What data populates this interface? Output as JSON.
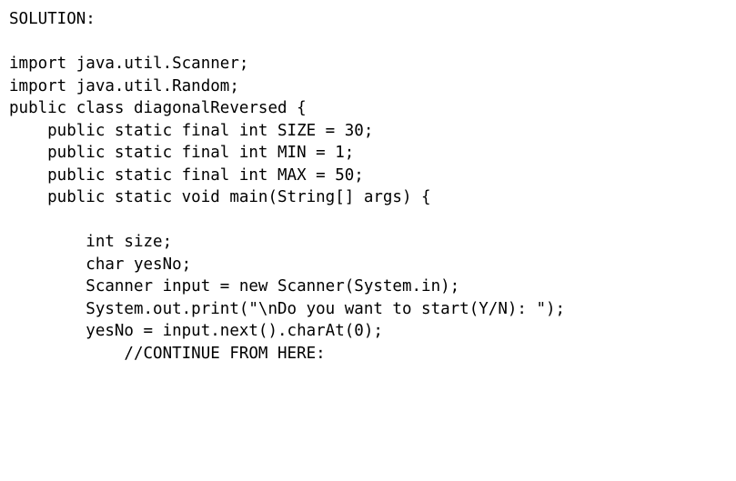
{
  "document": {
    "heading": "SOLUTION:",
    "language": "java",
    "background_color": "#ffffff",
    "text_color": "#000000",
    "class_name": "diagonalReversed",
    "constants": [
      {
        "name": "SIZE",
        "type": "int",
        "value": "30"
      },
      {
        "name": "MIN",
        "type": "int",
        "value": "1"
      },
      {
        "name": "MAX",
        "type": "int",
        "value": "50"
      }
    ],
    "prompt_text": "\\nDo you want to start(Y/N): ",
    "trailing_comment": "//CONTINUE FROM HERE:"
  },
  "code": {
    "lines": [
      "SOLUTION:",
      "",
      "import java.util.Scanner;",
      "import java.util.Random;",
      "public class diagonalReversed {",
      "    public static final int SIZE = 30;",
      "    public static final int MIN = 1;",
      "    public static final int MAX = 50;",
      "    public static void main(String[] args) {",
      "",
      "        int size;",
      "        char yesNo;",
      "        Scanner input = new Scanner(System.in);",
      "        System.out.print(\"\\nDo you want to start(Y/N): \");",
      "        yesNo = input.next().charAt(0);",
      "            //CONTINUE FROM HERE:"
    ]
  }
}
